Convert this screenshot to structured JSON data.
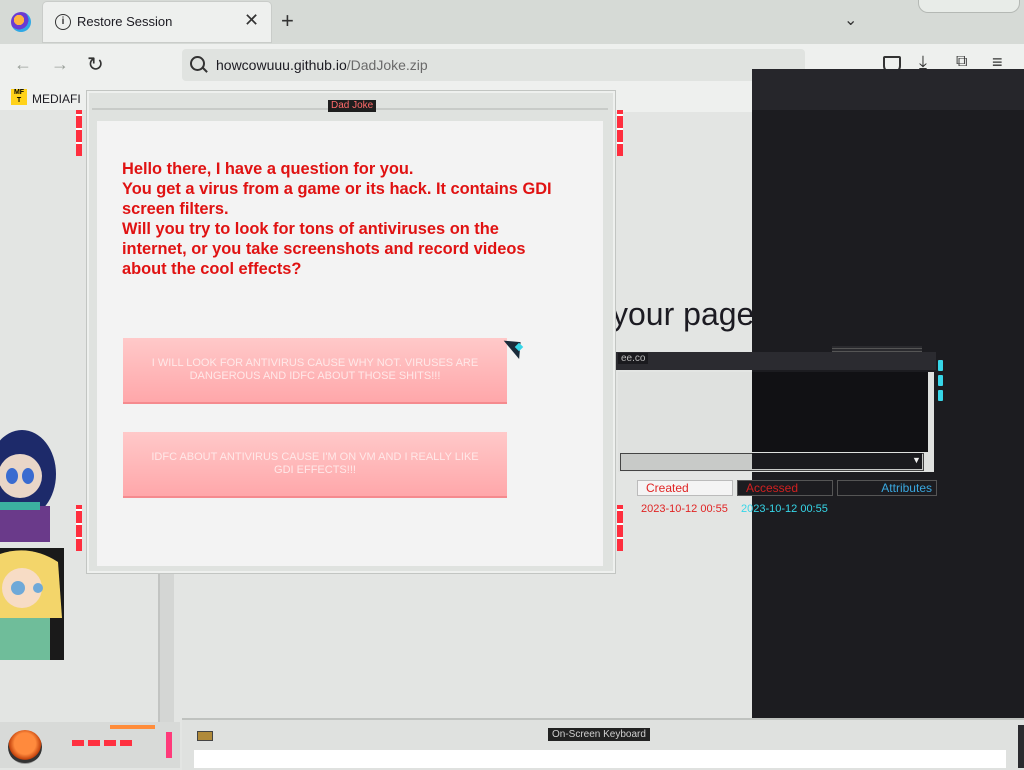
{
  "browser": {
    "tab_title": "Restore Session",
    "tab_close": "✕",
    "new_tab": "+",
    "tab_list": "⌄",
    "url_host": "howcowuuu.github.io",
    "url_path": "/DadJoke.zip",
    "back": "←",
    "forward": "→",
    "reload": "↻",
    "download": "⤓",
    "extensions": "⧉",
    "menu": "≡",
    "bookmark_label": "MEDIAFI",
    "bookmark_icon_text": "MF T"
  },
  "background_page": {
    "heading": "your pages back."
  },
  "explorer": {
    "title": "ee.co",
    "columns": [
      "Created",
      "Accessed",
      "Attributes"
    ],
    "row": {
      "created": "2023-10-12 00:55",
      "accessed": "2023-10-12 00:55"
    },
    "dropdown_arrow": "▼"
  },
  "keyboard_window": {
    "title": "On-Screen Keyboard"
  },
  "dialog": {
    "title": "Dad Joke",
    "message_lines": [
      "Hello there, I have a question for you.",
      "You get a virus from a game or its hack. It contains GDI screen filters.",
      "Will you try to look for tons of antiviruses on the internet, or you take screenshots and record videos about the cool effects?"
    ],
    "choices": [
      "I WILL LOOK FOR ANTIVIRUS CAUSE WHY NOT. VIRUSES ARE DANGEROUS AND IDFC ABOUT THOSE SHITS!!!",
      "IDFC ABOUT ANTIVIRUS CAUSE I'M ON VM AND I REALLY LIKE GDI EFFECTS!!!"
    ]
  }
}
